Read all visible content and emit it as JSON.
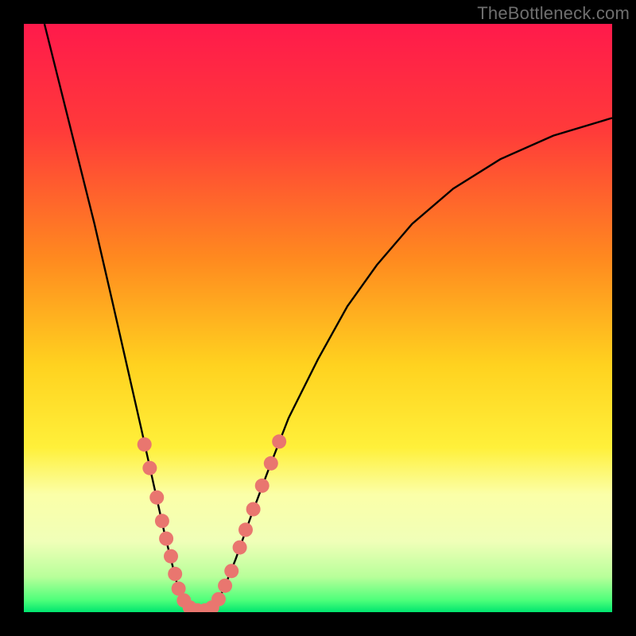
{
  "watermark": "TheBottleneck.com",
  "chart_data": {
    "type": "line",
    "title": "",
    "xlabel": "",
    "ylabel": "",
    "xlim": [
      0,
      100
    ],
    "ylim": [
      0,
      100
    ],
    "gradient_stops": [
      {
        "offset": 0,
        "color": "#ff1a4b"
      },
      {
        "offset": 18,
        "color": "#ff3a3a"
      },
      {
        "offset": 40,
        "color": "#ff8a1f"
      },
      {
        "offset": 58,
        "color": "#ffd21f"
      },
      {
        "offset": 72,
        "color": "#fff03a"
      },
      {
        "offset": 80,
        "color": "#fbffa8"
      },
      {
        "offset": 88,
        "color": "#f0ffb8"
      },
      {
        "offset": 94,
        "color": "#b8ff9a"
      },
      {
        "offset": 98,
        "color": "#4dff7a"
      },
      {
        "offset": 100,
        "color": "#00e56f"
      }
    ],
    "curve_points": [
      {
        "x": 3.5,
        "y": 100
      },
      {
        "x": 6.0,
        "y": 90
      },
      {
        "x": 9.0,
        "y": 78
      },
      {
        "x": 12.0,
        "y": 66
      },
      {
        "x": 15.0,
        "y": 53
      },
      {
        "x": 17.5,
        "y": 42
      },
      {
        "x": 20.0,
        "y": 31
      },
      {
        "x": 22.0,
        "y": 22
      },
      {
        "x": 24.0,
        "y": 13
      },
      {
        "x": 25.5,
        "y": 7
      },
      {
        "x": 26.5,
        "y": 3
      },
      {
        "x": 27.5,
        "y": 1
      },
      {
        "x": 29.0,
        "y": 0
      },
      {
        "x": 31.0,
        "y": 0
      },
      {
        "x": 32.5,
        "y": 1
      },
      {
        "x": 34.0,
        "y": 4
      },
      {
        "x": 36.0,
        "y": 9
      },
      {
        "x": 38.5,
        "y": 16
      },
      {
        "x": 41.5,
        "y": 24
      },
      {
        "x": 45.0,
        "y": 33
      },
      {
        "x": 50.0,
        "y": 43
      },
      {
        "x": 55.0,
        "y": 52
      },
      {
        "x": 60.0,
        "y": 59
      },
      {
        "x": 66.0,
        "y": 66
      },
      {
        "x": 73.0,
        "y": 72
      },
      {
        "x": 81.0,
        "y": 77
      },
      {
        "x": 90.0,
        "y": 81
      },
      {
        "x": 100.0,
        "y": 84
      }
    ],
    "marker_points": [
      {
        "x": 20.5,
        "y": 28.5
      },
      {
        "x": 21.4,
        "y": 24.5
      },
      {
        "x": 22.6,
        "y": 19.5
      },
      {
        "x": 23.5,
        "y": 15.5
      },
      {
        "x": 24.2,
        "y": 12.5
      },
      {
        "x": 25.0,
        "y": 9.5
      },
      {
        "x": 25.7,
        "y": 6.5
      },
      {
        "x": 26.3,
        "y": 4.0
      },
      {
        "x": 27.2,
        "y": 2.0
      },
      {
        "x": 28.2,
        "y": 0.8
      },
      {
        "x": 29.5,
        "y": 0.3
      },
      {
        "x": 30.8,
        "y": 0.3
      },
      {
        "x": 32.0,
        "y": 0.8
      },
      {
        "x": 33.1,
        "y": 2.2
      },
      {
        "x": 34.2,
        "y": 4.5
      },
      {
        "x": 35.3,
        "y": 7.0
      },
      {
        "x": 36.7,
        "y": 11.0
      },
      {
        "x": 37.7,
        "y": 14.0
      },
      {
        "x": 39.0,
        "y": 17.5
      },
      {
        "x": 40.5,
        "y": 21.5
      },
      {
        "x": 42.0,
        "y": 25.3
      },
      {
        "x": 43.4,
        "y": 29.0
      }
    ],
    "marker_color": "#e9766f",
    "curve_color": "#000000"
  }
}
